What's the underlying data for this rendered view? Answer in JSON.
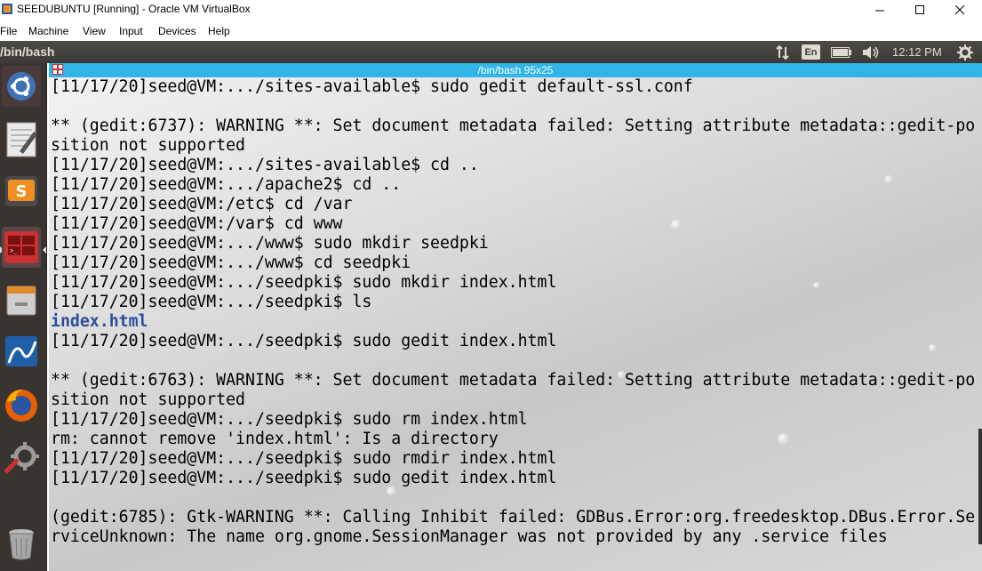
{
  "host": {
    "title": "SEEDUBUNTU [Running] - Oracle VM VirtualBox",
    "minimize_icon": "minimize-icon",
    "maximize_icon": "maximize-icon",
    "close_icon": "close-icon",
    "menu": [
      "File",
      "Machine",
      "View",
      "Input",
      "Devices",
      "Help"
    ]
  },
  "panel": {
    "title": "/bin/bash",
    "keyboard": "En",
    "clock": "12:12 PM",
    "tray_icons": [
      "network-updown-icon",
      "keyboard-layout-icon",
      "battery-icon",
      "volume-icon",
      "gear-icon"
    ]
  },
  "launcher": {
    "items": [
      "ubuntu-dash-icon",
      "text-editor-icon",
      "sublime-text-icon",
      "terminal-icon",
      "file-manager-icon",
      "wireshark-icon",
      "firefox-icon",
      "system-settings-icon",
      "trash-icon"
    ]
  },
  "terminal": {
    "title": "/bin/bash 95x25",
    "lines": [
      "[11/17/20]seed@VM:.../sites-available$ sudo gedit default-ssl.conf",
      "",
      "** (gedit:6737): WARNING **: Set document metadata failed: Setting attribute metadata::gedit-po",
      "sition not supported",
      "[11/17/20]seed@VM:.../sites-available$ cd ..",
      "[11/17/20]seed@VM:.../apache2$ cd ..",
      "[11/17/20]seed@VM:/etc$ cd /var",
      "[11/17/20]seed@VM:/var$ cd www",
      "[11/17/20]seed@VM:.../www$ sudo mkdir seedpki",
      "[11/17/20]seed@VM:.../www$ cd seedpki",
      "[11/17/20]seed@VM:.../seedpki$ sudo mkdir index.html",
      "[11/17/20]seed@VM:.../seedpki$ ls",
      "index.html",
      "[11/17/20]seed@VM:.../seedpki$ sudo gedit index.html",
      "",
      "** (gedit:6763): WARNING **: Set document metadata failed: Setting attribute metadata::gedit-po",
      "sition not supported",
      "[11/17/20]seed@VM:.../seedpki$ sudo rm index.html",
      "rm: cannot remove 'index.html': Is a directory",
      "[11/17/20]seed@VM:.../seedpki$ sudo rmdir index.html",
      "[11/17/20]seed@VM:.../seedpki$ sudo gedit index.html",
      "",
      "(gedit:6785): Gtk-WARNING **: Calling Inhibit failed: GDBus.Error:org.freedesktop.DBus.Error.Se",
      "rviceUnknown: The name org.gnome.SessionManager was not provided by any .service files"
    ]
  },
  "colors": {
    "terminal_titlebar": "#2fb6e6",
    "directory_listing": "#2a4e9a",
    "panel_bg": "#3c3b37",
    "launcher_bg": "#3a3431"
  }
}
